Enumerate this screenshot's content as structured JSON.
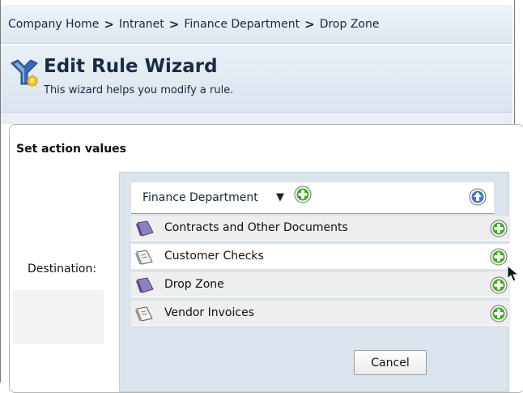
{
  "breadcrumb": {
    "items": [
      "Company Home",
      "Intranet",
      "Finance Department",
      "Drop Zone"
    ],
    "separator": ">"
  },
  "wizard": {
    "title": "Edit Rule Wizard",
    "description": "This wizard helps you modify a rule.",
    "icon": "wizard-icon"
  },
  "section": {
    "title": "Set action values",
    "destination_label": "Destination:"
  },
  "picker": {
    "current_folder": "Finance Department",
    "caret_icon": "caret-down-icon",
    "add_icon": "plus-circle-icon",
    "up_icon": "arrow-up-circle-icon",
    "items": [
      {
        "label": "Contracts and Other Documents",
        "icon": "space-icon"
      },
      {
        "label": "Customer Checks",
        "icon": "folder-icon"
      },
      {
        "label": "Drop Zone",
        "icon": "space-icon"
      },
      {
        "label": "Vendor Invoices",
        "icon": "folder-icon"
      }
    ],
    "cancel_label": "Cancel"
  },
  "colors": {
    "header_bg": "#dde7f1",
    "picker_bg": "#dbe3ec",
    "plus_green": "#2e9a1a",
    "space_purple": "#7e6aa8"
  }
}
